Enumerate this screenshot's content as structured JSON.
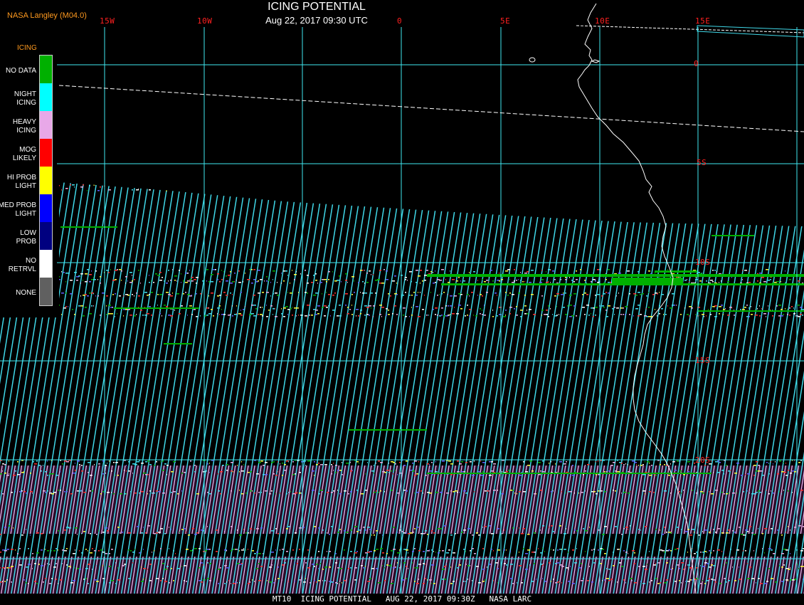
{
  "header": {
    "credit": "NASA Langley (M04.0)",
    "title": "ICING POTENTIAL",
    "datetime": "Aug 22, 2017 09:30 UTC"
  },
  "longitude_labels": [
    "15W",
    "10W",
    "0",
    "5E",
    "10E",
    "15E"
  ],
  "latitude_labels": [
    "0",
    "5S",
    "10S",
    "15S",
    "20S"
  ],
  "legend": {
    "title": "ICING",
    "items": [
      {
        "label": "NO DATA",
        "color": "#00b000"
      },
      {
        "label": "NIGHT\nICING",
        "color": "#00ffff"
      },
      {
        "label": "HEAVY\nICING",
        "color": "#e8a8e8"
      },
      {
        "label": "MOG\nLIKELY",
        "color": "#ff0000"
      },
      {
        "label": "HI PROB\nLIGHT",
        "color": "#ffff00"
      },
      {
        "label": "MED PROB\nLIGHT",
        "color": "#0000ff"
      },
      {
        "label": "LOW\nPROB",
        "color": "#000080"
      },
      {
        "label": "NO\nRETRVL",
        "color": "#ffffff"
      },
      {
        "label": "NONE",
        "color": "#606060"
      }
    ]
  },
  "colors": {
    "grid": "#40e8f0",
    "stripe": "#40d8e8",
    "stripe_pink": "#e8b0e8",
    "coast": "#ffffff",
    "background": "#000000"
  },
  "footer": "MT10  ICING POTENTIAL   AUG 22, 2017 09:30Z   NASA LARC"
}
